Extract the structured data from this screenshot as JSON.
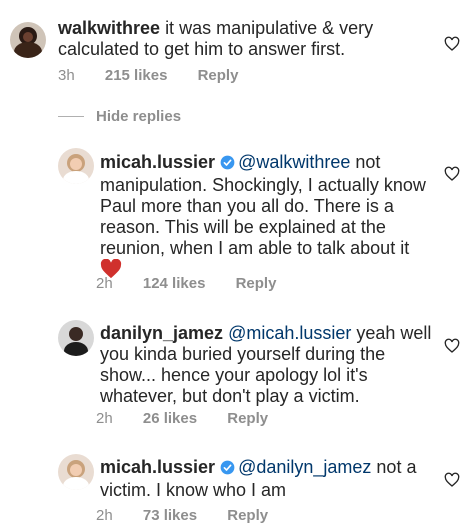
{
  "comments": [
    {
      "username": "walkwithree",
      "verified": false,
      "text_lines": [
        "it was manipulative & very",
        "calculated to get him to answer first."
      ],
      "time": "3h",
      "likes": "215 likes",
      "reply": "Reply"
    },
    {
      "username": "micah.lussier",
      "verified": true,
      "mention": "@walkwithree",
      "text_lines": [
        "not",
        "manipulation. Shockingly, I actually know",
        "Paul more than you all do. There is a",
        "reason. This will be explained at the",
        "reunion, when I am able to talk about it"
      ],
      "emoji": "red-heart",
      "time": "2h",
      "likes": "124 likes",
      "reply": "Reply"
    },
    {
      "username": "danilyn_jamez",
      "verified": false,
      "mention": "@micah.lussier",
      "text_lines": [
        "yeah well",
        "you kinda buried yourself during the",
        "show... hence your apology lol it's",
        "whatever, but don't play a victim."
      ],
      "time": "2h",
      "likes": "26 likes",
      "reply": "Reply"
    },
    {
      "username": "micah.lussier",
      "verified": true,
      "mention": "@danilyn_jamez",
      "text_lines": [
        "not a",
        "victim. I know who I am"
      ],
      "time": "2h",
      "likes": "73 likes",
      "reply": "Reply"
    }
  ],
  "hide_replies": "Hide replies",
  "icons": {
    "like": "heart-outline-icon",
    "verified": "verified-badge-icon",
    "emoji": "red-heart-emoji"
  },
  "colors": {
    "text": "#262626",
    "mention": "#00376b",
    "meta": "#8e8e8e",
    "verified": "#3897f0",
    "heart": "#d0312d"
  }
}
